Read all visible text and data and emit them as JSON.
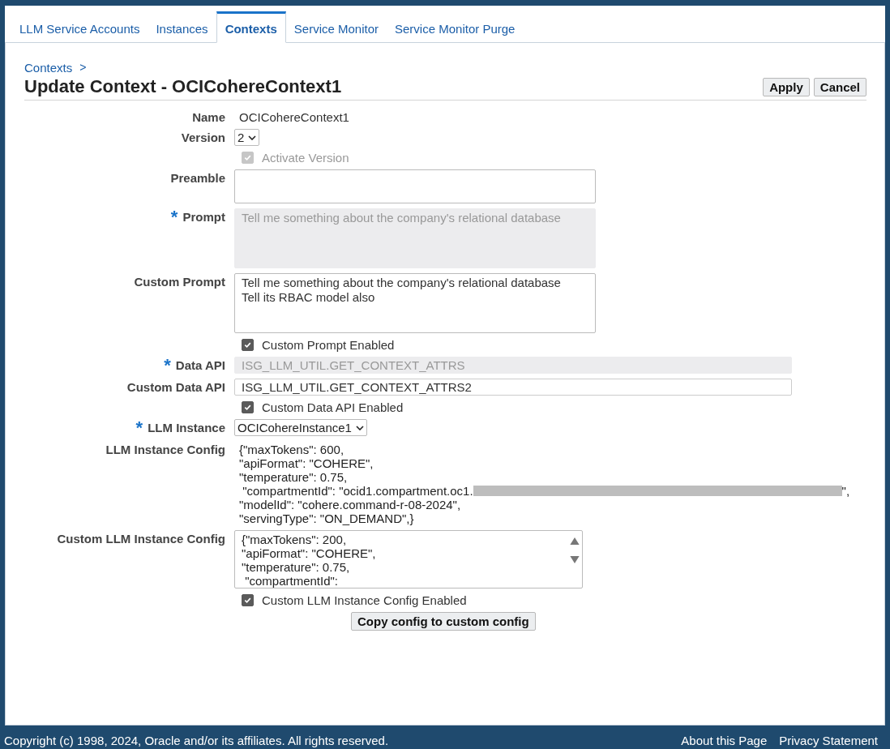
{
  "tabs": [
    {
      "label": "LLM Service Accounts",
      "selected": false
    },
    {
      "label": "Instances",
      "selected": false
    },
    {
      "label": "Contexts",
      "selected": true
    },
    {
      "label": "Service Monitor",
      "selected": false
    },
    {
      "label": "Service Monitor Purge",
      "selected": false
    }
  ],
  "breadcrumb": {
    "label": "Contexts",
    "separator": ">"
  },
  "page_title": "Update Context - OCICohereContext1",
  "buttons": [
    "Apply",
    "Cancel"
  ],
  "fields": [
    {
      "kind": "text",
      "label": "Name",
      "value": "OCICohereContext1"
    },
    {
      "kind": "select",
      "label": "Version",
      "value": "2"
    },
    {
      "kind": "checkbox",
      "label": "Activate Version",
      "checked": true,
      "disabled": true
    },
    {
      "kind": "textbox",
      "label": "Preamble",
      "disabled": false
    },
    {
      "kind": "textarea",
      "label": "Prompt",
      "required_mark": "*",
      "disabled": true,
      "lines": [
        "Tell me something about the company's relational database"
      ]
    },
    {
      "kind": "textarea",
      "label": "Custom Prompt",
      "disabled": false,
      "lines": [
        "Tell me something about the company's relational database",
        "Tell its RBAC model also"
      ]
    },
    {
      "kind": "checkbox",
      "label": "Custom Prompt Enabled",
      "checked": true,
      "disabled": false
    },
    {
      "kind": "input",
      "label": "Data API",
      "required_mark": "*",
      "disabled": true,
      "value": "ISG_LLM_UTIL.GET_CONTEXT_ATTRS"
    },
    {
      "kind": "input",
      "label": "Custom Data API",
      "disabled": false,
      "value": "ISG_LLM_UTIL.GET_CONTEXT_ATTRS2"
    },
    {
      "kind": "checkbox",
      "label": "Custom Data API Enabled",
      "checked": true,
      "disabled": false
    },
    {
      "kind": "select",
      "label": "LLM Instance",
      "required_mark": "*",
      "value": "OCICohereInstance1"
    },
    {
      "kind": "config",
      "label": "LLM Instance Config",
      "lines": [
        {
          "text": "{\"maxTokens\": 600,",
          "redacted": false
        },
        {
          "text": "\"apiFormat\": \"COHERE\",",
          "redacted": false
        },
        {
          "text": "\"temperature\": 0.75,",
          "redacted": false
        },
        {
          "text": " \"compartmentId\": \"ocid1.compartment.oc1.",
          "redacted": true,
          "tail": "\","
        },
        {
          "text": "\"modelId\": \"cohere.command-r-08-2024\",",
          "redacted": false
        },
        {
          "text": "\"servingType\": \"ON_DEMAND\",}",
          "redacted": false
        }
      ]
    },
    {
      "kind": "scrollarea",
      "label": "Custom LLM Instance Config",
      "lines": [
        "{\"maxTokens\": 200,",
        "\"apiFormat\": \"COHERE\",",
        "\"temperature\": 0.75,",
        " \"compartmentId\":"
      ]
    },
    {
      "kind": "checkbox",
      "label": "Custom LLM Instance Config Enabled",
      "checked": true,
      "disabled": false
    },
    {
      "kind": "button",
      "label": "Copy config to custom config"
    }
  ],
  "footer": {
    "copyright": "Copyright (c) 1998, 2024, Oracle and/or its affiliates. All rights reserved.",
    "links": [
      "About this Page",
      "Privacy Statement"
    ]
  }
}
